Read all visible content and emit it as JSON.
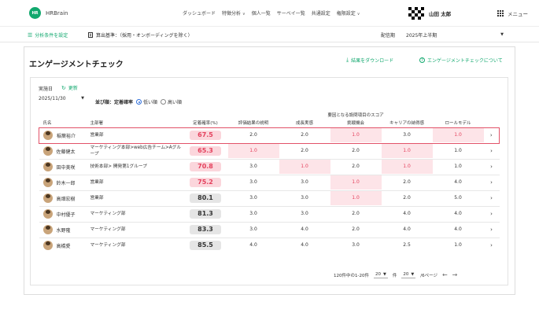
{
  "header": {
    "logo_mark": "HR",
    "logo_text": "HRBrain",
    "nav": [
      {
        "label": "ダッシュボード",
        "caret": false
      },
      {
        "label": "特徴分析",
        "caret": true
      },
      {
        "label": "個人一覧",
        "caret": false
      },
      {
        "label": "サーベイ一覧",
        "caret": false
      },
      {
        "label": "共通設定",
        "caret": false
      },
      {
        "label": "権限設定",
        "caret": true
      }
    ],
    "user_name": "山田 太郎",
    "menu_label": "メニュー"
  },
  "subbar": {
    "filter_label": "分析条件を設定",
    "calc_label": "算出基準：（採用・オンボーディングを除く）",
    "period_label": "配信期",
    "period_value": "2025年上半期"
  },
  "page": {
    "title": "エンゲージメントチェック",
    "download_label": "結果をダウンロード",
    "about_label": "エンゲージメントチェックについて",
    "exec_label": "実施日",
    "refresh_label": "更新",
    "date_value": "2025/11/30",
    "sort_label": "並び順：定着確率",
    "sort_low": "低い順",
    "sort_high": "高い順"
  },
  "table": {
    "group_header": "要因となる設問項目のスコア",
    "headers": {
      "name": "氏名",
      "dept": "主部署",
      "rate": "定着確率(%)",
      "scores": [
        "評価結果の説明",
        "成長実感",
        "挑戦機会",
        "キャリアの納得感",
        "ロールモデル"
      ]
    },
    "rows": [
      {
        "name": "稲葉裕介",
        "dept": "営業部",
        "rate": "67.5",
        "rate_level": "low",
        "scores": [
          "2.0",
          "2.0",
          "1.0",
          "3.0",
          "1.0"
        ],
        "lows": [
          false,
          false,
          true,
          false,
          true
        ],
        "selected": true
      },
      {
        "name": "佐藤健太",
        "dept": "マーケティング本部>web広告チーム>Aグループ",
        "rate": "65.3",
        "rate_level": "low",
        "scores": [
          "1.0",
          "2.0",
          "2.0",
          "1.0",
          "1.0"
        ],
        "lows": [
          true,
          false,
          false,
          true,
          false
        ],
        "selected": false
      },
      {
        "name": "田中美咲",
        "dept": "技術本部> 開発第1グループ",
        "rate": "70.8",
        "rate_level": "low",
        "scores": [
          "3.0",
          "1.0",
          "2.0",
          "1.0",
          "1.0"
        ],
        "lows": [
          false,
          true,
          false,
          true,
          false
        ],
        "selected": false
      },
      {
        "name": "鈴木一郎",
        "dept": "営業部",
        "rate": "75.2",
        "rate_level": "low",
        "scores": [
          "3.0",
          "3.0",
          "1.0",
          "2.0",
          "4.0"
        ],
        "lows": [
          false,
          false,
          true,
          false,
          false
        ],
        "selected": false
      },
      {
        "name": "高畑宏樹",
        "dept": "営業部",
        "rate": "80.1",
        "rate_level": "mid",
        "scores": [
          "3.0",
          "3.0",
          "1.0",
          "2.0",
          "5.0"
        ],
        "lows": [
          false,
          false,
          true,
          false,
          false
        ],
        "selected": false
      },
      {
        "name": "中村優子",
        "dept": "マーケティング部",
        "rate": "81.3",
        "rate_level": "mid",
        "scores": [
          "3.0",
          "3.0",
          "2.0",
          "4.0",
          "4.0"
        ],
        "lows": [
          false,
          false,
          false,
          false,
          false
        ],
        "selected": false
      },
      {
        "name": "水野隆",
        "dept": "マーケティング部",
        "rate": "83.3",
        "rate_level": "mid",
        "scores": [
          "3.0",
          "4.0",
          "2.0",
          "4.0",
          "4.0"
        ],
        "lows": [
          false,
          false,
          false,
          false,
          false
        ],
        "selected": false
      },
      {
        "name": "高橋愛",
        "dept": "マーケティング部",
        "rate": "85.5",
        "rate_level": "mid",
        "scores": [
          "4.0",
          "4.0",
          "3.0",
          "2.5",
          "1.0"
        ],
        "lows": [
          false,
          false,
          false,
          false,
          false
        ],
        "selected": false
      }
    ]
  },
  "pagination": {
    "range_label": "120件中の1-20件",
    "per_page": "20",
    "per_page_unit": "件",
    "page": "20",
    "page_total": "/6ページ"
  },
  "colors": {
    "brand": "#11a86e",
    "low_text": "#e4415d",
    "low_bg": "#fde4e8",
    "selected_border": "#e25268"
  }
}
